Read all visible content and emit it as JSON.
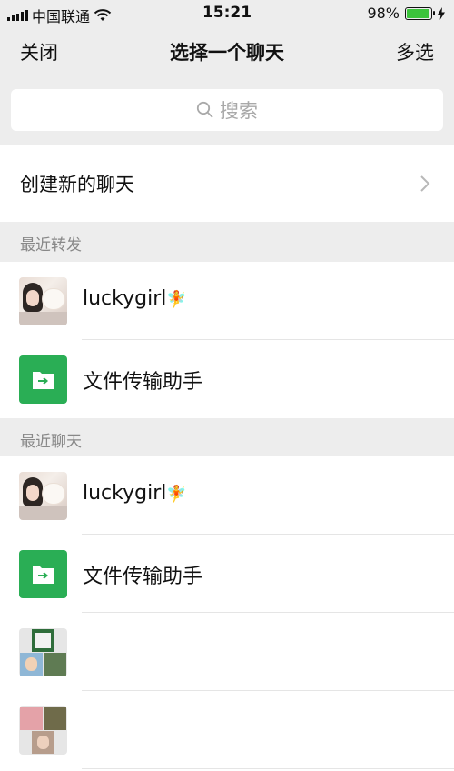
{
  "status_bar": {
    "carrier": "中国联通",
    "time": "15:21",
    "battery": "98%",
    "battery_level": 0.98
  },
  "nav": {
    "left": "关闭",
    "title": "选择一个聊天",
    "right": "多选"
  },
  "search": {
    "placeholder": "搜索"
  },
  "create_chat": {
    "label": "创建新的聊天"
  },
  "sections": {
    "recent_forward": {
      "label": "最近转发"
    },
    "recent_chats": {
      "label": "最近聊天"
    }
  },
  "recent_forward": [
    {
      "name": "luckygirl",
      "avatar": "photo"
    },
    {
      "name": "文件传输助手",
      "avatar": "file-transfer"
    }
  ],
  "recent_chats": [
    {
      "name": "luckygirl",
      "avatar": "photo"
    },
    {
      "name": "文件传输助手",
      "avatar": "file-transfer"
    },
    {
      "name": "",
      "avatar": "group-grid"
    },
    {
      "name": "",
      "avatar": "group-grid"
    }
  ],
  "colors": {
    "accent_green": "#2aae55",
    "background_gray": "#ededed"
  }
}
